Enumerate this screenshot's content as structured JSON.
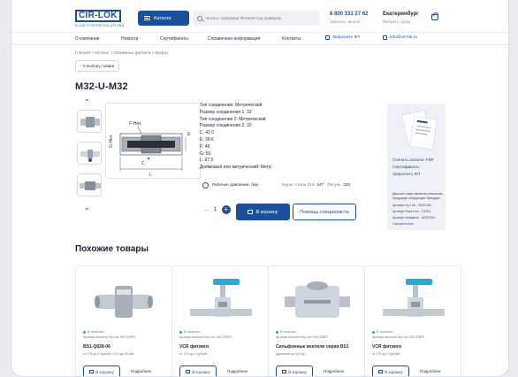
{
  "header": {
    "logo_text": "CIR-LOK",
    "logo_tagline": "FLUID SYSTEM SOLUTIONS",
    "catalog_label": "Каталог",
    "search_placeholder": "Искать: например Фитинги под приварку",
    "phone": "8 800 333 27 62",
    "callback_label": "Заказать звонок",
    "city": "Екатеринбург",
    "city_sub": "Выбрать город"
  },
  "nav": {
    "items": [
      "О компании",
      "Новости",
      "Сертификаты",
      "Справочная информация",
      "Контакты"
    ],
    "request_label": "Запросить КП",
    "email": "info@cir-lok.ru"
  },
  "breadcrumb": "Главная  >  Каталог  >  Обжимные фитинги  >  Муфты",
  "back_label": "К выбору товара",
  "product": {
    "title": "M32-U-M32",
    "specs": [
      "Тип соединения: Метрический",
      "Размер соединения 1: 32",
      "Тип соединения 2: Метрический",
      "Размер соединения 2: 32",
      "C: 42.0",
      "E: 28.6",
      "F: 46",
      "G: 50",
      "L: 97.5",
      "Дюймовый или метрический: Метр"
    ],
    "pressure_label": "Рабочее давление, бар",
    "steel_label": "Нерж. сталь 316",
    "steel_value": "447",
    "latun_label": "Латунь",
    "latun_value": "320",
    "quantity": "1",
    "cart_label": "В корзину",
    "help_label": "Помощь специалиста"
  },
  "catalog_card": {
    "download": "Скачать каталог PDF",
    "certificates": "Сертификаты",
    "request": "Запросить КП",
    "note": "Данный товар является аналогом продукции следующих брендов:",
    "articles": [
      "Артикул Hy-Lok - W32C6N",
      "Артикул Fluid-Line - 9132J",
      "Артикул Swagelok - W32C6N"
    ],
    "more": "Смотреть все"
  },
  "similar": {
    "title": "Похожие товары",
    "cards": [
      {
        "stock": "В наличии",
        "article": "Артикул аналога Hy-Lok: WS-328F0",
        "name": "BS1-Q828-06",
        "price": "от 175 до 2 рублей / от 5 до 55 мм",
        "cart": "В корзину",
        "more": "Подробнее"
      },
      {
        "stock": "В наличии",
        "article": "Артикул аналога Hy-Lok: WS-328F0",
        "name": "VCR фитинги",
        "price": "от 175 до 2 рублей",
        "cart": "В корзину",
        "more": "Подробнее"
      },
      {
        "stock": "В наличии",
        "article": "Артикул аналога Hy-Lok: WS-328F0",
        "name": "Сильфонные вентили серии BS1",
        "price": "Давление до 64 бар",
        "cart": "В корзину",
        "more": "Подробнее"
      },
      {
        "stock": "В наличии",
        "article": "Артикул аналога Hy-Lok: WS-328F0",
        "name": "VCR фитинги",
        "price": "от 175 до 2 рублей",
        "cart": "В корзину",
        "more": "Подробнее"
      }
    ]
  },
  "colors": {
    "accent": "#1a4f9c",
    "stock": "#3ea55a",
    "valve_handle": "#2aa8d6"
  }
}
